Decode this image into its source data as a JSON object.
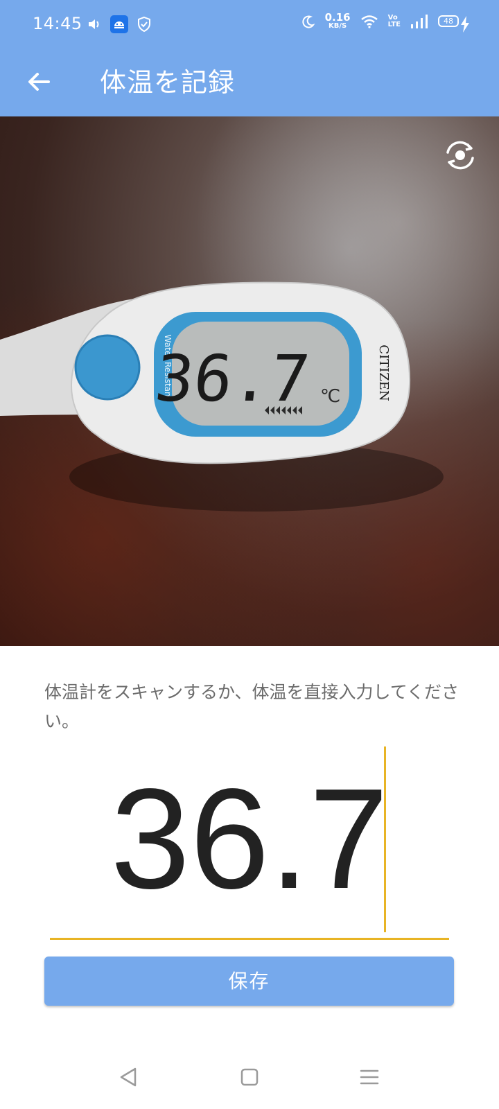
{
  "status_bar": {
    "time": "14:45",
    "net_speed_value": "0.16",
    "net_speed_unit": "KB/S",
    "volte_top": "Vo",
    "volte_bottom": "LTE",
    "battery_level": "48"
  },
  "app_bar": {
    "title": "体温を記録"
  },
  "camera": {
    "scene": "thermometer",
    "display_reading": "36.7",
    "brand": "CITIZEN",
    "side_text": "Water Resistant"
  },
  "form": {
    "instructions": "体温計をスキャンするか、体温を直接入力してください。",
    "temperature_value": "36.7",
    "save_label": "保存"
  },
  "colors": {
    "accent": "#76a9ec",
    "underline": "#e8b425",
    "text_muted": "#6b6b6b",
    "text_main": "#222222"
  },
  "icons": {
    "back": "arrow-left-icon",
    "switch_camera": "camera-switch-icon",
    "nav_back": "nav-back-icon",
    "nav_home": "nav-home-icon",
    "nav_recents": "nav-recents-icon"
  }
}
